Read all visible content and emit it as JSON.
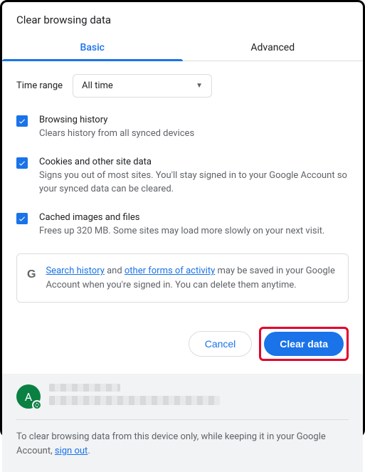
{
  "dialog": {
    "title": "Clear browsing data"
  },
  "tabs": {
    "basic": "Basic",
    "advanced": "Advanced"
  },
  "time_range": {
    "label": "Time range",
    "selected": "All time"
  },
  "options": {
    "history": {
      "title": "Browsing history",
      "desc": "Clears history from all synced devices",
      "checked": true
    },
    "cookies": {
      "title": "Cookies and other site data",
      "desc": "Signs you out of most sites. You'll stay signed in to your Google Account so your synced data can be cleared.",
      "checked": true
    },
    "cache": {
      "title": "Cached images and files",
      "desc": "Frees up 320 MB. Some sites may load more slowly on your next visit.",
      "checked": true
    }
  },
  "notice": {
    "link1": "Search history",
    "mid1": " and ",
    "link2": "other forms of activity",
    "rest": " may be saved in your Google Account when you're signed in. You can delete them anytime."
  },
  "buttons": {
    "cancel": "Cancel",
    "clear": "Clear data"
  },
  "account": {
    "avatar_letter": "A"
  },
  "footer": {
    "text_before": "To clear browsing data from this device only, while keeping it in your Google Account, ",
    "signout_link": "sign out",
    "text_after": "."
  }
}
